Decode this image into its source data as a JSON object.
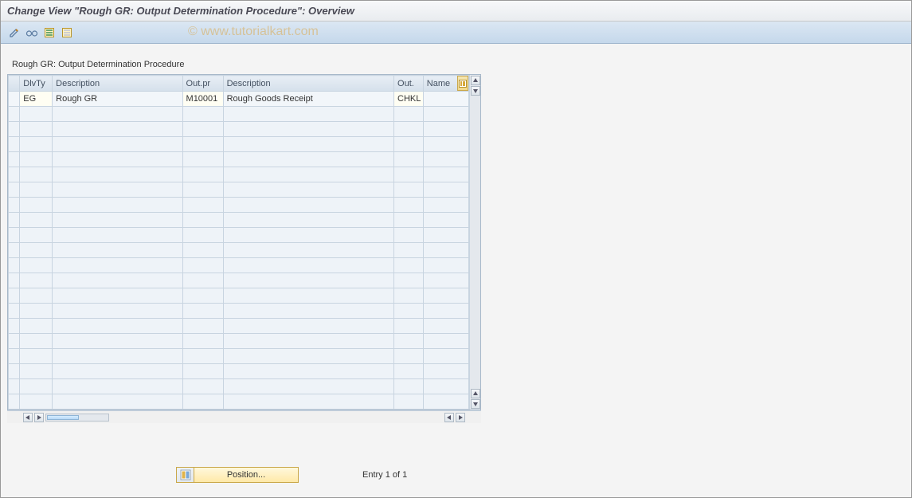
{
  "title": "Change View \"Rough GR: Output Determination Procedure\": Overview",
  "watermark": "© www.tutorialkart.com",
  "panel_title": "Rough GR: Output Determination Procedure",
  "columns": {
    "dlvty": "DlvTy",
    "desc1": "Description",
    "outpr": "Out.pr",
    "desc2": "Description",
    "out": "Out.",
    "name": "Name"
  },
  "rows": [
    {
      "dlvty": "EG",
      "desc1": "Rough GR",
      "outpr": "M10001",
      "desc2": "Rough Goods Receipt",
      "out": "CHKL",
      "name": ""
    }
  ],
  "empty_row_count": 20,
  "position_button": "Position...",
  "entry_text": "Entry 1 of 1",
  "toolbar_icons": [
    "pencil-icon",
    "glasses-icon",
    "select-all-icon",
    "deselect-all-icon"
  ]
}
